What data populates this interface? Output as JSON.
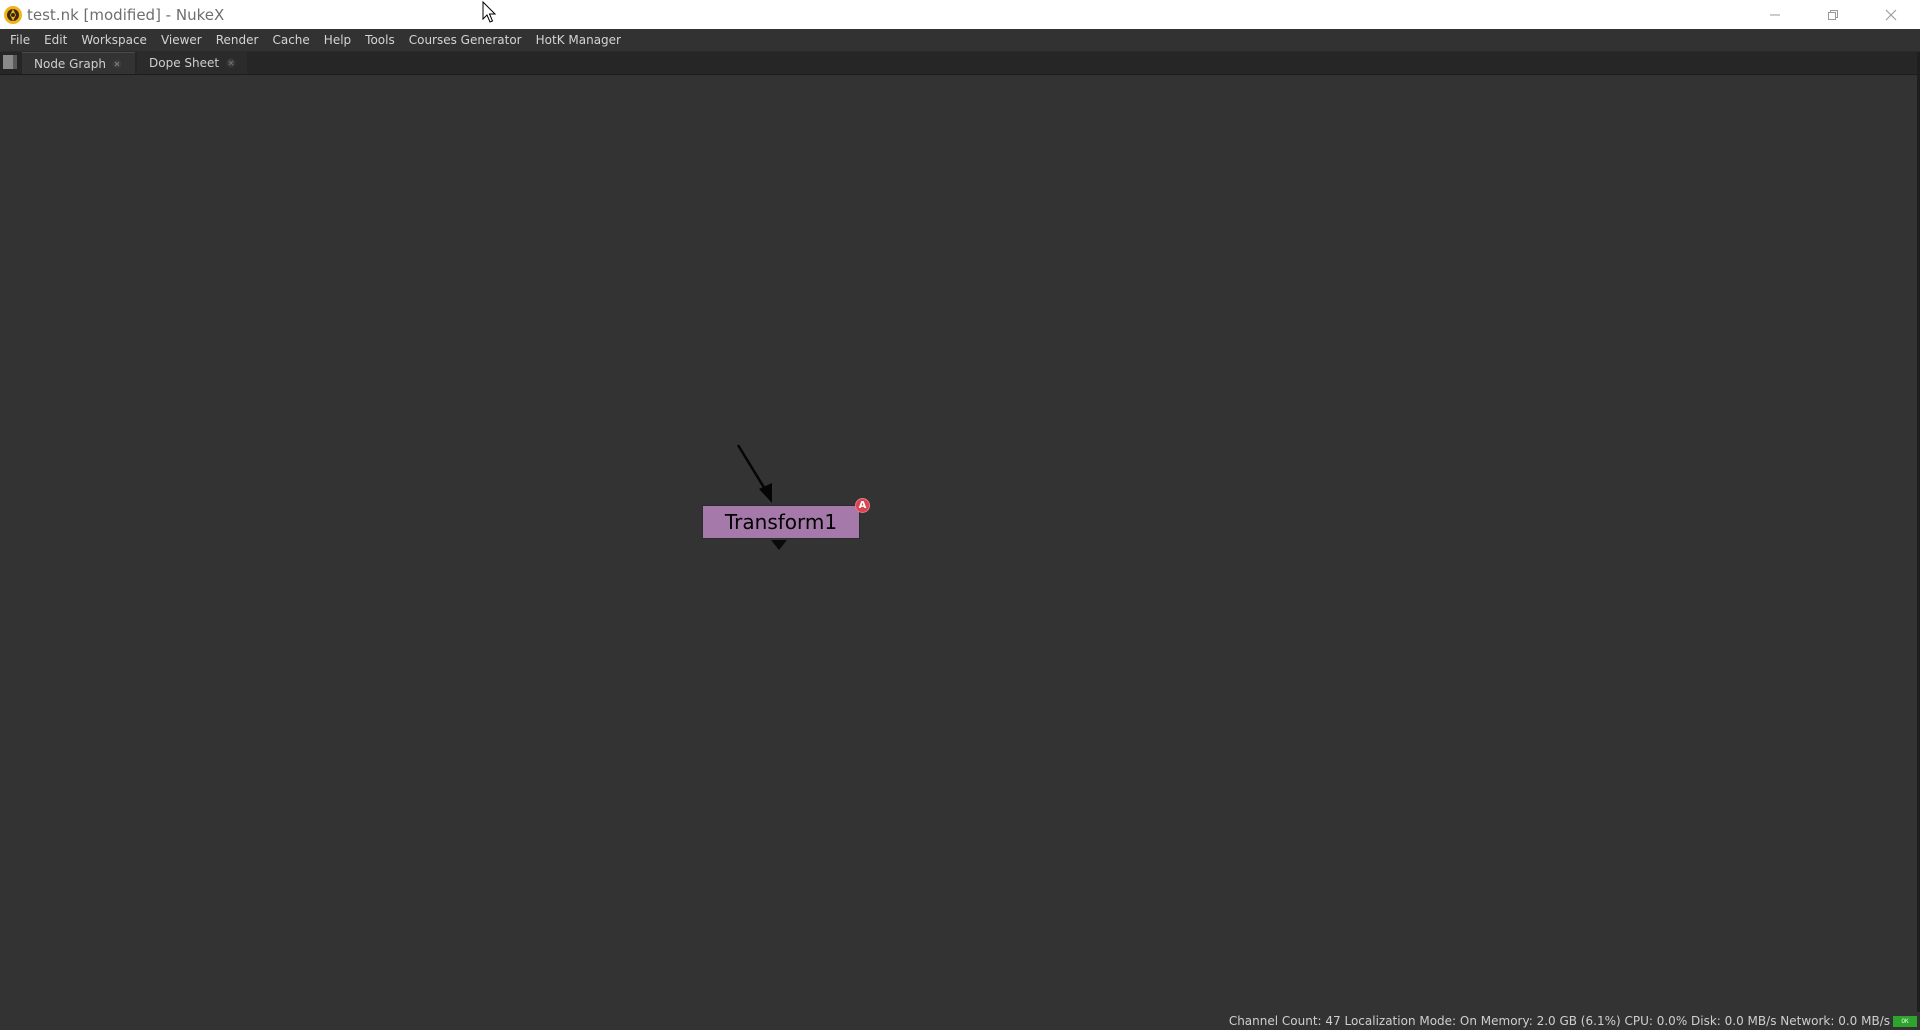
{
  "window": {
    "title": "test.nk [modified] - NukeX",
    "logo_icon": "nuke-logo-icon",
    "controls": [
      "minimize-icon",
      "restore-icon",
      "close-icon"
    ]
  },
  "menubar": {
    "items": [
      {
        "label": "File"
      },
      {
        "label": "Edit"
      },
      {
        "label": "Workspace"
      },
      {
        "label": "Viewer"
      },
      {
        "label": "Render"
      },
      {
        "label": "Cache"
      },
      {
        "label": "Help"
      },
      {
        "label": "Tools"
      },
      {
        "label": "Courses Generator"
      },
      {
        "label": "HotK Manager"
      }
    ]
  },
  "tabs": [
    {
      "label": "Node Graph",
      "active": true
    },
    {
      "label": "Dope Sheet",
      "active": false
    }
  ],
  "node_graph": {
    "nodes": [
      {
        "label": "Transform1",
        "color": "#a57aaa",
        "badge": "A",
        "badge_color": "#d94452"
      }
    ]
  },
  "statusbar": {
    "text": "Channel Count: 47  Localization Mode: On  Memory: 2.0 GB (6.1%)  CPU: 0.0%  Disk: 0.0 MB/s  Network: 0.0 MB/s",
    "indicator": "OK",
    "indicator_color": "#2ea32e"
  }
}
